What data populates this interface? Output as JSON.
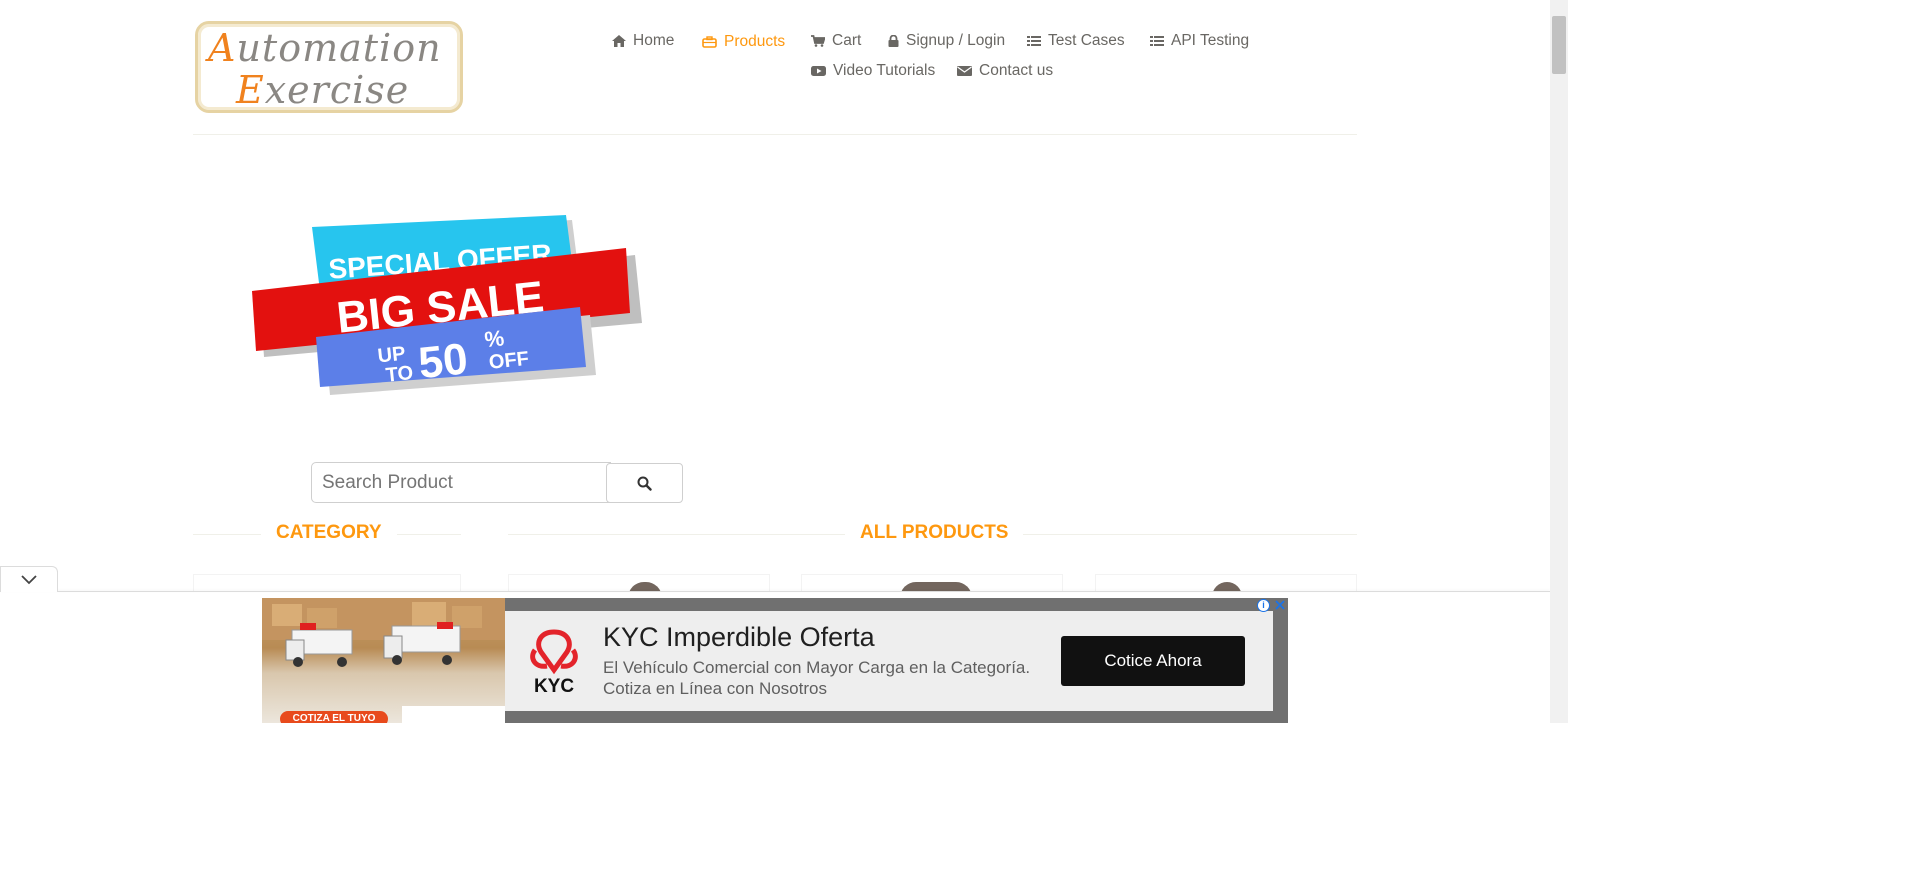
{
  "logo": {
    "line1": "Automation",
    "line2": "Exercise"
  },
  "nav": [
    {
      "label": "Home",
      "icon": "home-icon"
    },
    {
      "label": "Products",
      "icon": "briefcase-icon",
      "active": true
    },
    {
      "label": "Cart",
      "icon": "cart-icon"
    },
    {
      "label": "Signup / Login",
      "icon": "lock-icon"
    },
    {
      "label": "Test Cases",
      "icon": "list-icon"
    },
    {
      "label": "API Testing",
      "icon": "list-icon"
    },
    {
      "label": "Video Tutorials",
      "icon": "youtube-play-icon"
    },
    {
      "label": "Contact us",
      "icon": "envelope-icon"
    }
  ],
  "banner": {
    "line1": "SPECIAL OFFER",
    "line2": "BIG SALE",
    "up": "UP",
    "to": "TO",
    "percent": "50",
    "pct_sign": "%",
    "off": "OFF"
  },
  "search": {
    "placeholder": "Search Product",
    "icon": "search-icon"
  },
  "sections": {
    "category": "CATEGORY",
    "all_products": "ALL PRODUCTS"
  },
  "ad": {
    "title": "KYC Imperdible Oferta",
    "subtitle_line1": "El Vehículo Comercial con Mayor Carga en la Categoría.",
    "subtitle_line2": "Cotiza en Línea con Nosotros",
    "cta": "Cotice Ahora",
    "brand": "KYC",
    "photo_tag": "COTIZA EL TUYO",
    "info_icon": "i"
  },
  "colors": {
    "accent": "#fe980f",
    "text": "#696763",
    "ad_button": "#111111",
    "kyc_red": "#e3242b"
  }
}
